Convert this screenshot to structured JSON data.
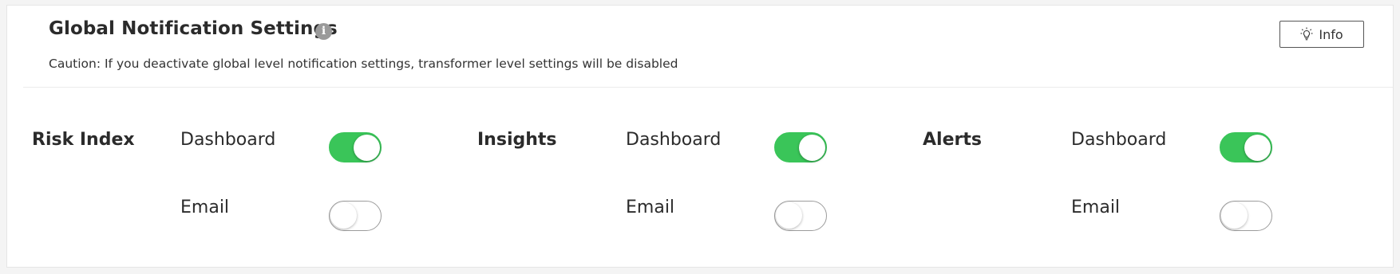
{
  "header": {
    "title": "Global Notification Settings",
    "title_info_glyph": "i",
    "caution": "Caution: If you deactivate global level notification settings, transformer level settings will be disabled",
    "info_button_label": "Info",
    "info_button_icon": "lightbulb-icon"
  },
  "colors": {
    "toggle_on": "#3ac559",
    "toggle_off_border": "#9c9c9c",
    "info_icon_bg": "#9a9a9a"
  },
  "groups": [
    {
      "label": "Risk Index",
      "options": [
        {
          "label": "Dashboard",
          "enabled": true
        },
        {
          "label": "Email",
          "enabled": false
        }
      ]
    },
    {
      "label": "Insights",
      "options": [
        {
          "label": "Dashboard",
          "enabled": true
        },
        {
          "label": "Email",
          "enabled": false
        }
      ]
    },
    {
      "label": "Alerts",
      "options": [
        {
          "label": "Dashboard",
          "enabled": true
        },
        {
          "label": "Email",
          "enabled": false
        }
      ]
    }
  ]
}
